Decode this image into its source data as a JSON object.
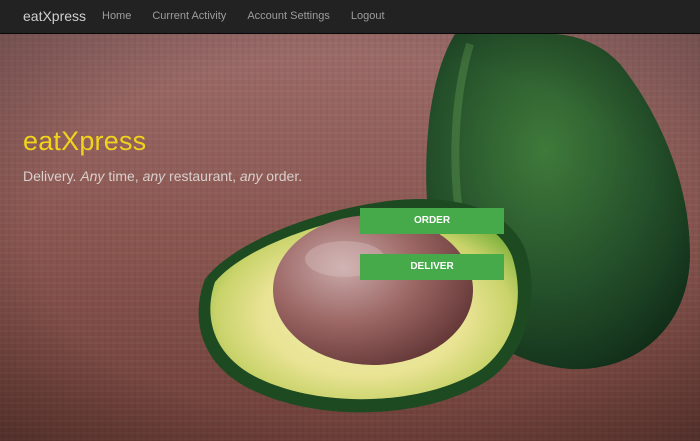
{
  "navbar": {
    "brand": "eatXpress",
    "links": [
      "Home",
      "Current Activity",
      "Account Settings",
      "Logout"
    ]
  },
  "hero": {
    "title": "eatXpress",
    "tagline": {
      "p1": "Delivery. ",
      "p2": "Any",
      "p3": " time, ",
      "p4": "any",
      "p5": " restaurant, ",
      "p6": "any",
      "p7": " order."
    },
    "title_color": "#f2d31b",
    "background_image": "avocado-on-burlap"
  },
  "actions": {
    "order_label": "ORDER",
    "deliver_label": "DELIVER",
    "button_color": "#46a94a"
  }
}
